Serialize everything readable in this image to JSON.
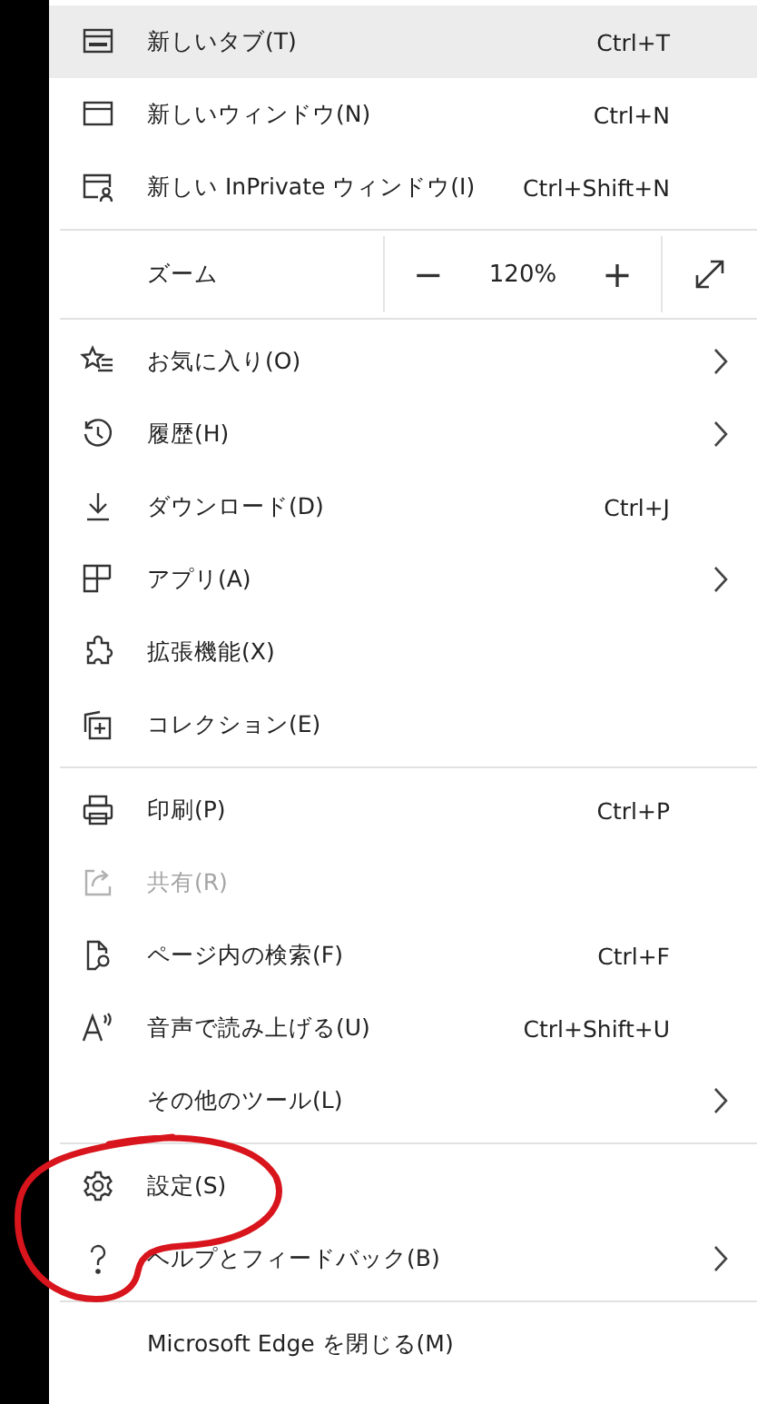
{
  "menu": {
    "groups": [
      {
        "items": [
          {
            "kind": "item",
            "label": "新しいタブ(T)",
            "shortcut": "Ctrl+T",
            "submenu": false,
            "disabled": false,
            "selected": true
          },
          {
            "kind": "item",
            "label": "新しいウィンドウ(N)",
            "shortcut": "Ctrl+N",
            "submenu": false,
            "disabled": false,
            "selected": false
          },
          {
            "kind": "item",
            "label": "新しい InPrivate ウィンドウ(I)",
            "shortcut": "Ctrl+Shift+N",
            "submenu": false,
            "disabled": false,
            "selected": false
          }
        ]
      },
      {
        "items": [
          {
            "kind": "zoom",
            "label": "ズーム",
            "minus": "−",
            "value": "120%",
            "plus": "+"
          }
        ]
      },
      {
        "items": [
          {
            "kind": "item",
            "label": "お気に入り(O)",
            "submenu": true,
            "disabled": false,
            "selected": false
          },
          {
            "kind": "item",
            "label": "履歴(H)",
            "submenu": true,
            "disabled": false,
            "selected": false
          },
          {
            "kind": "item",
            "label": "ダウンロード(D)",
            "shortcut": "Ctrl+J",
            "submenu": false,
            "disabled": false,
            "selected": false
          },
          {
            "kind": "item",
            "label": "アプリ(A)",
            "submenu": true,
            "disabled": false,
            "selected": false
          },
          {
            "kind": "item",
            "label": "拡張機能(X)",
            "submenu": false,
            "disabled": false,
            "selected": false
          },
          {
            "kind": "item",
            "label": "コレクション(E)",
            "submenu": false,
            "disabled": false,
            "selected": false
          }
        ]
      },
      {
        "items": [
          {
            "kind": "item",
            "label": "印刷(P)",
            "shortcut": "Ctrl+P",
            "submenu": false,
            "disabled": false,
            "selected": false
          },
          {
            "kind": "item",
            "label": "共有(R)",
            "submenu": false,
            "disabled": true,
            "selected": false
          },
          {
            "kind": "item",
            "label": "ページ内の検索(F)",
            "shortcut": "Ctrl+F",
            "submenu": false,
            "disabled": false,
            "selected": false
          },
          {
            "kind": "item",
            "label": "音声で読み上げる(U)",
            "shortcut": "Ctrl+Shift+U",
            "submenu": false,
            "disabled": false,
            "selected": false
          },
          {
            "kind": "item",
            "label": "その他のツール(L)",
            "submenu": true,
            "disabled": false,
            "selected": false
          }
        ]
      },
      {
        "items": [
          {
            "kind": "item",
            "label": "設定(S)",
            "submenu": false,
            "disabled": false,
            "selected": false
          },
          {
            "kind": "item",
            "label": "ヘルプとフィードバック(B)",
            "submenu": true,
            "disabled": false,
            "selected": false
          }
        ]
      },
      {
        "items": [
          {
            "kind": "item",
            "label": "Microsoft Edge を閉じる(M)",
            "submenu": false,
            "disabled": false,
            "selected": false
          }
        ]
      }
    ]
  },
  "annotation": {
    "kind": "circle"
  }
}
